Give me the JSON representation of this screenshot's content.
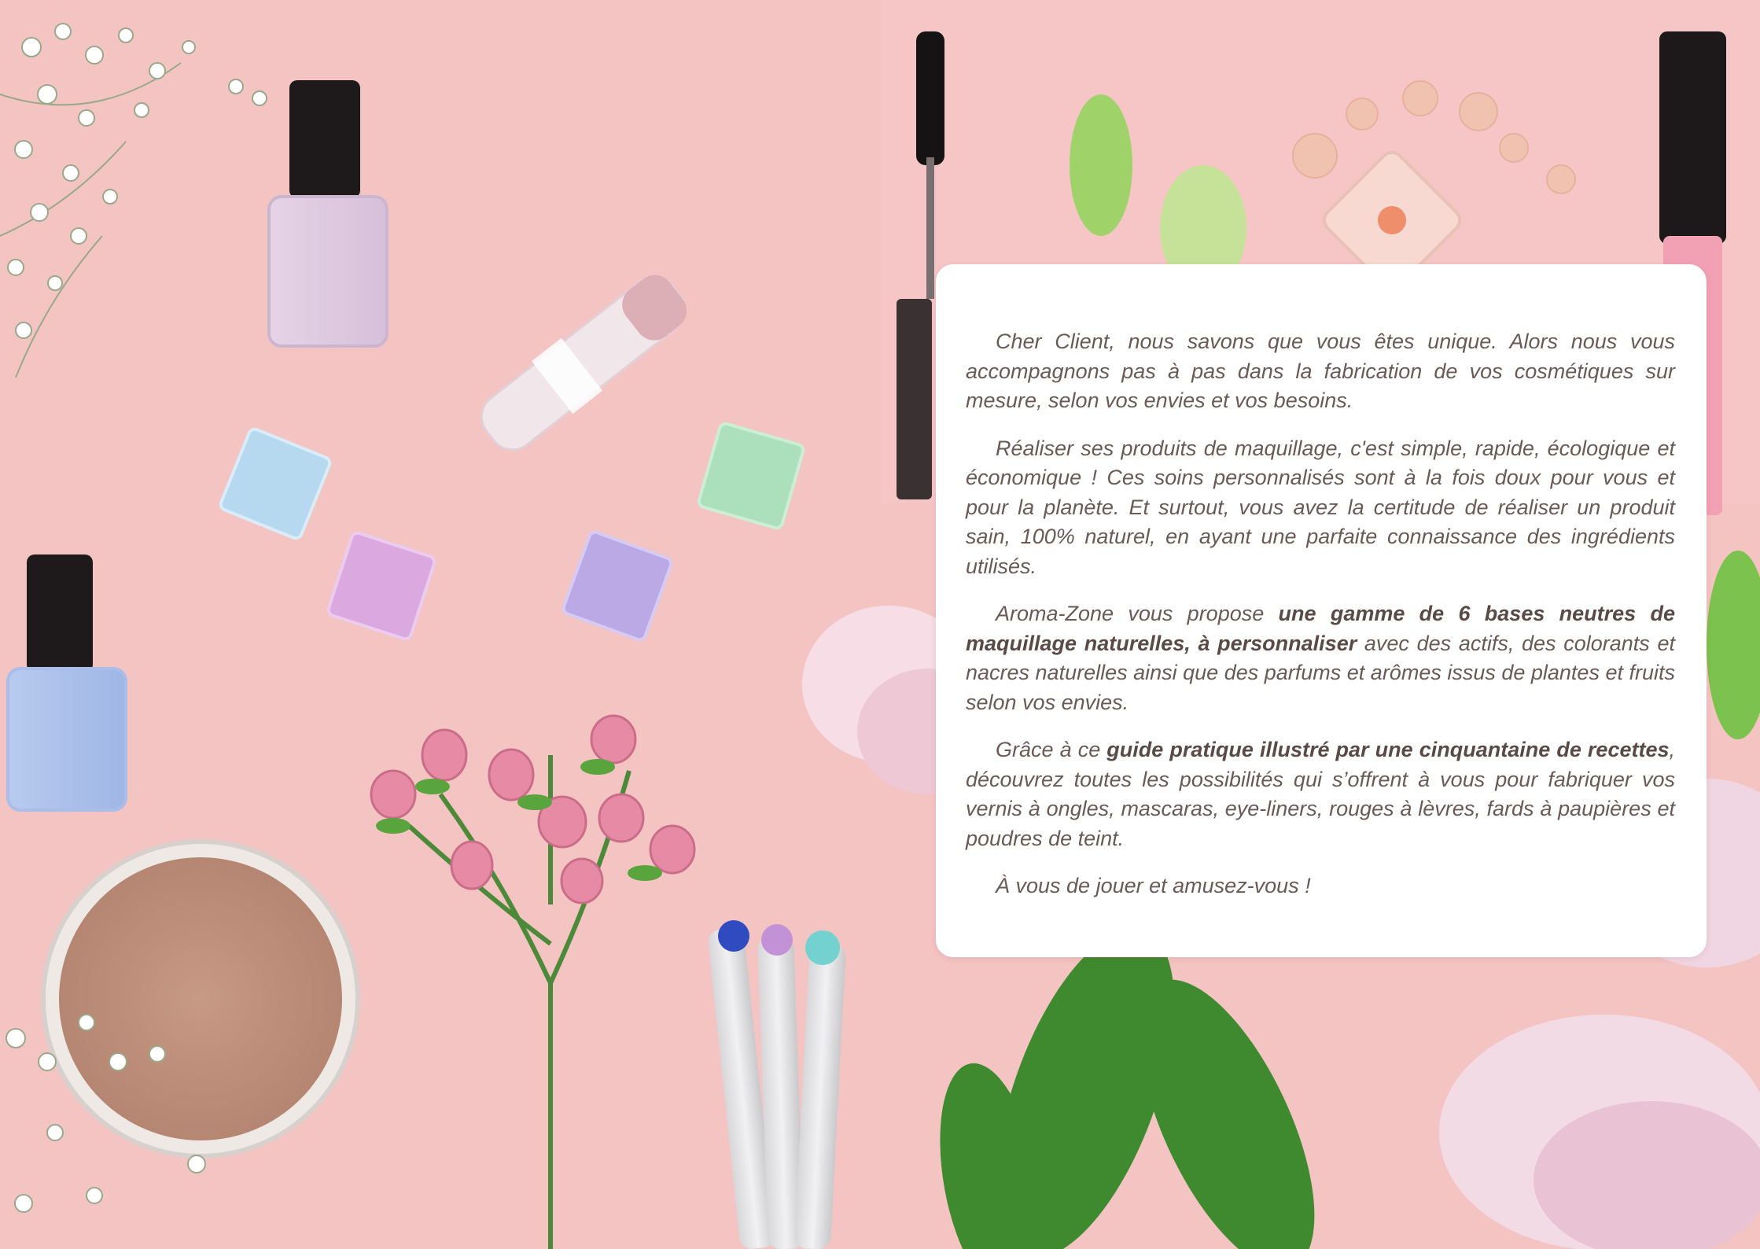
{
  "colors": {
    "background": "#f4c4c2",
    "card": "#ffffff",
    "text": "#6a5a56"
  },
  "intro": {
    "p1": "Cher Client, nous savons que vous êtes unique. Alors nous vous accompagnons pas à pas dans la fabrication de vos cosmétiques sur mesure, selon vos envies et vos besoins.",
    "p2": "Réaliser ses produits de maquillage, c'est simple, rapide, écologique et économique ! Ces soins personnalisés sont à la fois doux pour vous et pour la planète. Et surtout, vous avez la certitude de réaliser un produit sain, 100% naturel, en ayant une parfaite connaissance des ingrédients utilisés.",
    "p3_before": "Aroma-Zone vous propose ",
    "p3_bold": "une gamme de 6 bases neutres de maquillage naturelles, à personnaliser",
    "p3_after": " avec des actifs, des colorants et nacres naturelles ainsi que des parfums et arômes issus de plantes et fruits selon vos envies.",
    "p4_before": "Grâce à ce ",
    "p4_bold": "guide pratique illustré par une cinquantaine de recettes",
    "p4_after": ", découvrez toutes les possibilités qui s’offrent à vous pour fabriquer vos vernis à ongles, mascaras, eye-liners, rouges à lèvres, fards à paupières et poudres de teint.",
    "p5": "À vous de jouer et amusez-vous !"
  }
}
